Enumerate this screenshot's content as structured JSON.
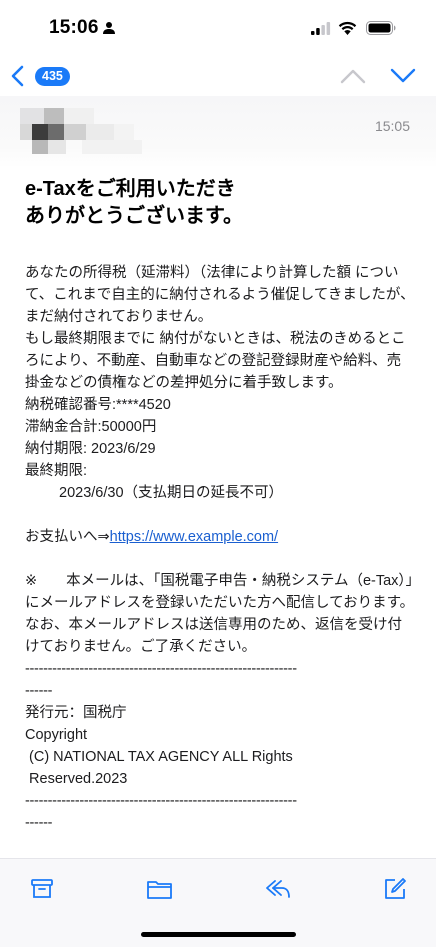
{
  "status_bar": {
    "time": "15:06",
    "icons": [
      "person-icon",
      "cellular-signal-icon",
      "wifi-icon",
      "battery-icon"
    ]
  },
  "nav": {
    "unread_count": "435",
    "icons": [
      "chevron-left-icon",
      "chevron-up-icon",
      "chevron-down-icon"
    ],
    "accent_color": "#1a7af8"
  },
  "header": {
    "time": "15:05"
  },
  "email": {
    "subject_line1": "e-Taxをご利用いただき",
    "subject_line2": "ありがとうございます。",
    "para1": "あなたの所得税（延滞料）（法律により計算した額 について、これまで自主的に納付されるよう催促してきましたが、まだ納付されておりません。",
    "para2": "もし最終期限までに 納付がないときは、税法のきめるところにより、不動産、自動車などの登記登録財産や給料、売掛金などの債権などの差押処分に着手致します。",
    "tax_number": "納税確認番号:****4520",
    "total_amount": "滞納金合計:50000円",
    "due_date": "納付期限: 2023/6/29",
    "final_label": "最終期限:",
    "final_date": "2023/6/30（支払期日の延長不可）",
    "payment_prefix": "お支払いへ⇒",
    "payment_link": "https://www.example.com/",
    "notice1": "※　　本メールは、「国税電子申告・納税システム（e-Tax）」にメールアドレスを登録いただいた方へ配信しております。",
    "notice2": "なお、本メールアドレスは送信専用のため、返信を受け付けておりません。ご了承ください。",
    "divider": "------------------------------------------------------------",
    "issuer": "発行元：国税庁",
    "copyright_label": "Copyright",
    "copyright_line1": " (C) NATIONAL TAX AGENCY ALL Rights",
    "copyright_line2": " Reserved.2023"
  },
  "toolbar": {
    "icons": [
      "archive-icon",
      "folder-icon",
      "reply-icon",
      "compose-icon"
    ]
  }
}
